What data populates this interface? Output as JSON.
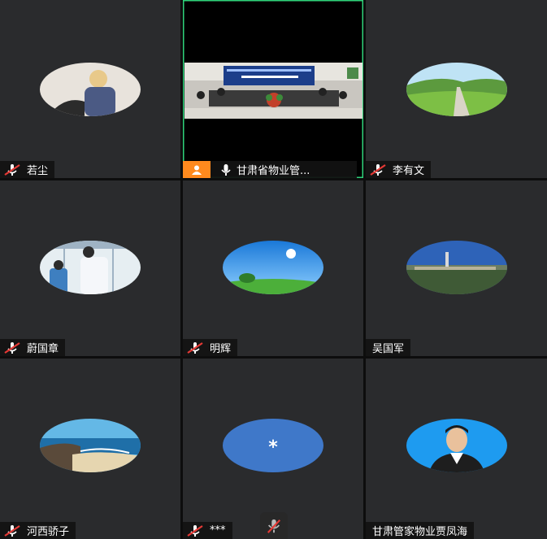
{
  "participants": [
    {
      "name": "若尘",
      "muted": true
    },
    {
      "name": "甘肃省物业管...",
      "muted": false,
      "active": true,
      "host": true
    },
    {
      "name": "李有文",
      "muted": true
    },
    {
      "name": "蔚国章",
      "muted": true
    },
    {
      "name": "明辉",
      "muted": true
    },
    {
      "name": "吴国军",
      "muted": false
    },
    {
      "name": "河西骄子",
      "muted": true
    },
    {
      "name": "***",
      "muted": true,
      "avatar_text": "*"
    },
    {
      "name": "甘肃管家物业贾凤海",
      "muted": false
    }
  ],
  "colors": {
    "active_border": "#2fd27a",
    "host_badge": "#ff8a1e",
    "muted_icon": "#e53935",
    "placeholder_avatar": "#3f78c9"
  }
}
